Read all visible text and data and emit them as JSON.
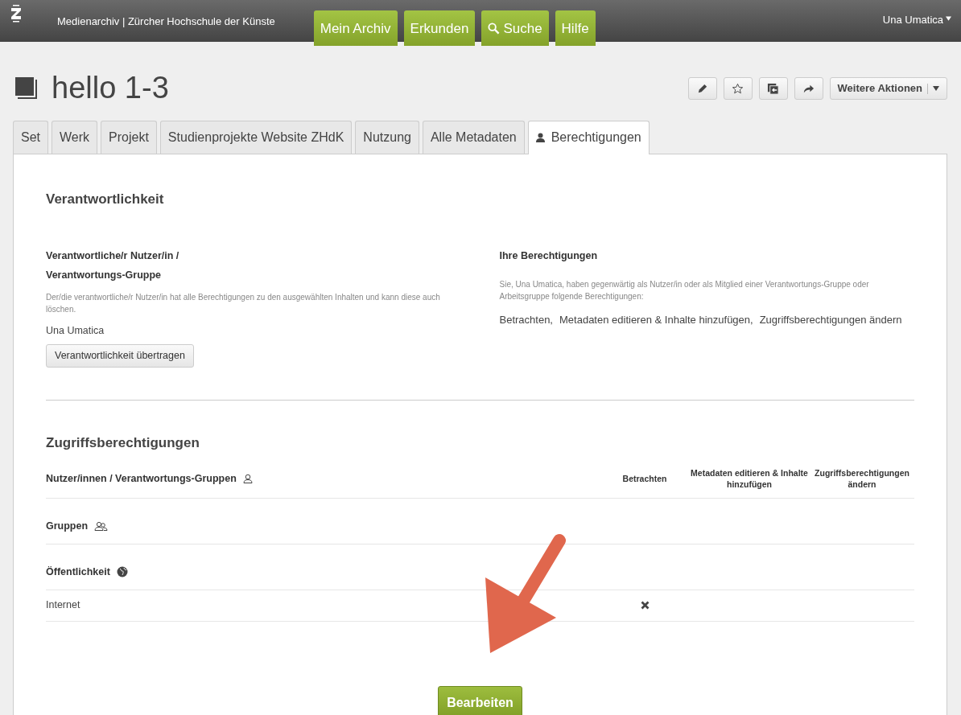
{
  "header": {
    "site_title": "Medienarchiv | Zürcher Hochschule der Künste",
    "nav": [
      {
        "label": "Mein Archiv",
        "kind": "text"
      },
      {
        "label": "Erkunden",
        "kind": "text"
      },
      {
        "label": "Suche",
        "kind": "search"
      },
      {
        "label": "Hilfe",
        "kind": "text"
      }
    ],
    "user": "Una Umatica"
  },
  "title": "hello 1-3",
  "actions": [
    {
      "kind": "edit"
    },
    {
      "kind": "favorite"
    },
    {
      "kind": "collection"
    },
    {
      "kind": "share"
    },
    {
      "kind": "more",
      "label": "Weitere Aktionen"
    }
  ],
  "tabs": [
    {
      "label": "Set",
      "selected": false
    },
    {
      "label": "Werk",
      "selected": false
    },
    {
      "label": "Projekt",
      "selected": false
    },
    {
      "label": "Studienprojekte Website ZHdK",
      "selected": false
    },
    {
      "label": "Nutzung",
      "selected": false
    },
    {
      "label": "Alle Metadaten",
      "selected": false
    },
    {
      "label": "Berechtigungen",
      "selected": true
    }
  ],
  "responsibility": {
    "heading": "Verantwortlichkeit",
    "owner_label_line1": "Verantwortliche/r Nutzer/in /",
    "owner_label_line2": "Verantwortungs-Gruppe",
    "owner_hint": "Der/die verantwortliche/r Nutzer/in hat alle Berechtigungen zu den ausgewählten Inhalten und kann diese auch löschen.",
    "owner": "Una Umatica",
    "transfer_button": "Verantwortlichkeit übertragen",
    "your_heading": "Ihre Berechtigungen",
    "your_hint": "Sie, Una Umatica, haben gegenwärtig als Nutzer/in oder als Mitglied einer Verantwortungs-Gruppe oder Arbeitsgruppe folgende Berechtigungen:",
    "your_permissions": [
      "Betrachten,",
      "Metadaten editieren & Inhalte hinzufügen,",
      "Zugriffsberechtigungen ändern"
    ]
  },
  "access": {
    "heading": "Zugriffsberechtigungen",
    "columns": [
      "Nutzer/innen / Verantwortungs-Gruppen",
      "Betrachten",
      "Metadaten editieren & Inhalte hinzufügen",
      "Zugriffsberechtigungen ändern"
    ],
    "sections": [
      {
        "label": "Gruppen",
        "kind": "groups"
      },
      {
        "label": "Öffentlichkeit",
        "kind": "public",
        "rows": [
          {
            "name": "Internet",
            "view": false
          }
        ]
      }
    ]
  },
  "edit_button": "Bearbeiten"
}
